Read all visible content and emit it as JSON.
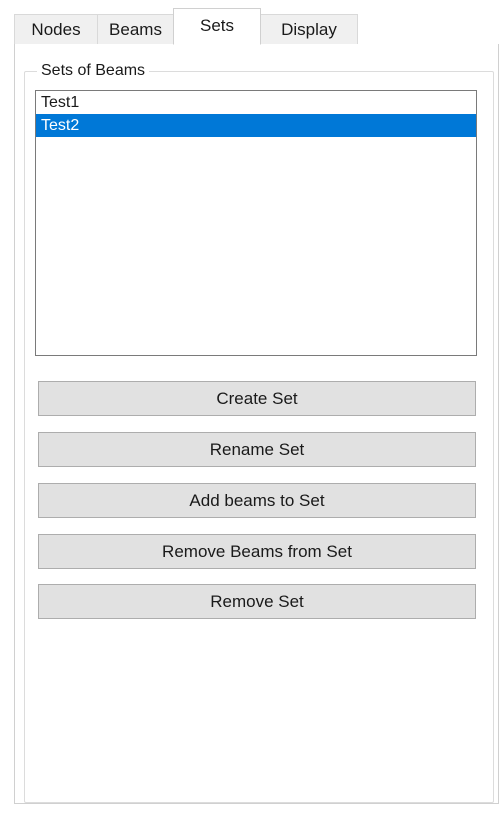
{
  "tabs": [
    {
      "label": "Nodes",
      "active": false
    },
    {
      "label": "Beams",
      "active": false
    },
    {
      "label": "Sets",
      "active": true
    },
    {
      "label": "Display",
      "active": false
    }
  ],
  "group": {
    "title": "Sets of Beams"
  },
  "sets_list": {
    "items": [
      {
        "label": "Test1",
        "selected": false
      },
      {
        "label": "Test2",
        "selected": true
      }
    ]
  },
  "buttons": {
    "create": "Create Set",
    "rename": "Rename Set",
    "add_beams": "Add beams to Set",
    "remove_beams": "Remove Beams from Set",
    "remove_set": "Remove Set"
  },
  "colors": {
    "selection": "#0078d7",
    "button_face": "#e1e1e1",
    "tab_inactive": "#f0f0f0"
  }
}
